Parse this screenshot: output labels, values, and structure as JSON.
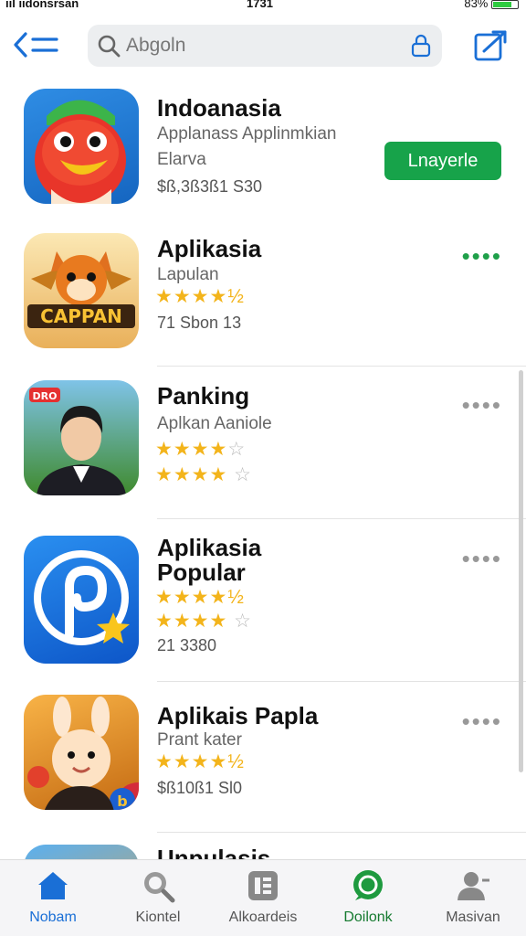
{
  "status_bar": {
    "carrier": "ııl ııdonsrsan",
    "time": "1731",
    "battery": "83%"
  },
  "search": {
    "placeholder": "Abgoln"
  },
  "apps": [
    {
      "name": "Indoanasia",
      "subtitle": "Applanass Applinmkian",
      "subtitle2": "Elarva",
      "meta": "$ß,3ß3ß1 S30",
      "action_label": "Lnayerle"
    },
    {
      "name": "Aplikasia",
      "subtitle": "Lapulan",
      "rating": "★★★★½",
      "meta": "71 Sbon   13"
    },
    {
      "name": "Panking",
      "subtitle": "Aplkan Aaniole",
      "rating": "★★★★☆",
      "rating2": "★★★★ ☆"
    },
    {
      "name": "Aplikasia Popular",
      "name_line1": "Aplikasia",
      "name_line2": "Popular",
      "rating": "★★★★½",
      "rating2": "★★★★ ☆",
      "meta": "21 3380"
    },
    {
      "name": "Aplikais Papla",
      "subtitle": "Prant kater",
      "rating": "★★★★½",
      "meta": "$ß10ß1   Sl0"
    },
    {
      "name": "Unpulasis"
    }
  ],
  "icon_labels": {
    "app2_banner": "CAPPAN",
    "app3_badge": "DRO"
  },
  "tabbar": [
    {
      "label": "Nobam",
      "icon": "home-icon",
      "active": true
    },
    {
      "label": "Kiontel",
      "icon": "search-icon"
    },
    {
      "label": "Alkoardeis",
      "icon": "apps-icon"
    },
    {
      "label": "Doilonk",
      "icon": "chat-icon"
    },
    {
      "label": "Masivan",
      "icon": "person-icon"
    }
  ],
  "colors": {
    "accent": "#1a6fd6",
    "get_button": "#17a34a",
    "star": "#f3b41b"
  }
}
